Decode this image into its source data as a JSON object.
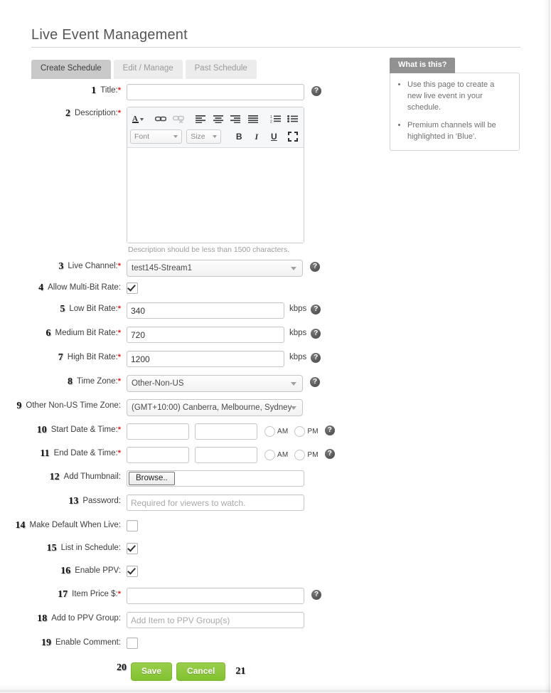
{
  "header": {
    "title": "Live Event Management"
  },
  "tabs": [
    {
      "label": "Create Schedule",
      "active": true
    },
    {
      "label": "Edit / Manage",
      "active": false
    },
    {
      "label": "Past Schedule",
      "active": false
    }
  ],
  "what_is_this": {
    "tab_label": "What is this?",
    "bullets": [
      "Use this page to create a new live event in your schedule.",
      "Premium channels will be highlighted in 'Blue'."
    ]
  },
  "editor": {
    "font_label": "Font",
    "size_label": "Size",
    "bold_label": "B",
    "italic_label": "I",
    "underline_label": "U",
    "hint": "Description should be less than 1500 characters."
  },
  "fields": {
    "title": {
      "num": "1",
      "label": "Title:",
      "required": true,
      "value": "",
      "placeholder": ""
    },
    "description": {
      "num": "2",
      "label": "Description:",
      "required": true,
      "value": ""
    },
    "live_channel": {
      "num": "3",
      "label": "Live Channel:",
      "required": true,
      "value": "test145-Stream1"
    },
    "allow_multibit": {
      "num": "4",
      "label": "Allow Multi-Bit Rate:",
      "required": false,
      "checked": true
    },
    "low_bit_rate": {
      "num": "5",
      "label": "Low Bit Rate:",
      "required": true,
      "value": "340",
      "unit": "kbps"
    },
    "medium_bit_rate": {
      "num": "6",
      "label": "Medium Bit Rate:",
      "required": true,
      "value": "720",
      "unit": "kbps"
    },
    "high_bit_rate": {
      "num": "7",
      "label": "High Bit Rate:",
      "required": true,
      "value": "1200",
      "unit": "kbps"
    },
    "time_zone": {
      "num": "8",
      "label": "Time Zone:",
      "required": true,
      "value": "Other-Non-US"
    },
    "other_time_zone": {
      "num": "9",
      "label": "Other Non-US Time Zone:",
      "required": false,
      "value": "(GMT+10:00) Canberra, Melbourne, Sydney"
    },
    "start_date_time": {
      "num": "10",
      "label": "Start Date & Time:",
      "required": true,
      "date": "",
      "time": "",
      "am_label": "AM",
      "pm_label": "PM"
    },
    "end_date_time": {
      "num": "11",
      "label": "End Date & Time:",
      "required": true,
      "date": "",
      "time": "",
      "am_label": "AM",
      "pm_label": "PM"
    },
    "add_thumbnail": {
      "num": "12",
      "label": "Add Thumbnail:",
      "required": false,
      "button_label": "Browse.."
    },
    "password": {
      "num": "13",
      "label": "Password:",
      "required": false,
      "value": "",
      "placeholder": "Required for viewers to watch."
    },
    "make_default_when_live": {
      "num": "14",
      "label": "Make Default When Live:",
      "required": false,
      "checked": false
    },
    "list_in_schedule": {
      "num": "15",
      "label": "List in Schedule:",
      "required": false,
      "checked": true
    },
    "enable_ppv": {
      "num": "16",
      "label": "Enable PPV:",
      "required": false,
      "checked": true
    },
    "item_price": {
      "num": "17",
      "label": "Item Price $:",
      "required": true,
      "value": "",
      "placeholder": ""
    },
    "add_to_ppv_group": {
      "num": "18",
      "label": "Add to PPV Group:",
      "required": false,
      "value": "",
      "placeholder": "Add Item to PPV Group(s)"
    },
    "enable_comment": {
      "num": "19",
      "label": "Enable Comment:",
      "required": false,
      "checked": false
    }
  },
  "actions": {
    "save_num": "20",
    "save_label": "Save",
    "cancel_label": "Cancel",
    "cancel_num": "21"
  },
  "icons": {
    "help": "?"
  },
  "colors": {
    "accent_green": "#8DC63F",
    "required_red": "#e02020",
    "tab_active_bg": "#c9c9c9",
    "tab_inactive_bg": "#ececec",
    "panel_header_bg": "#919191"
  }
}
